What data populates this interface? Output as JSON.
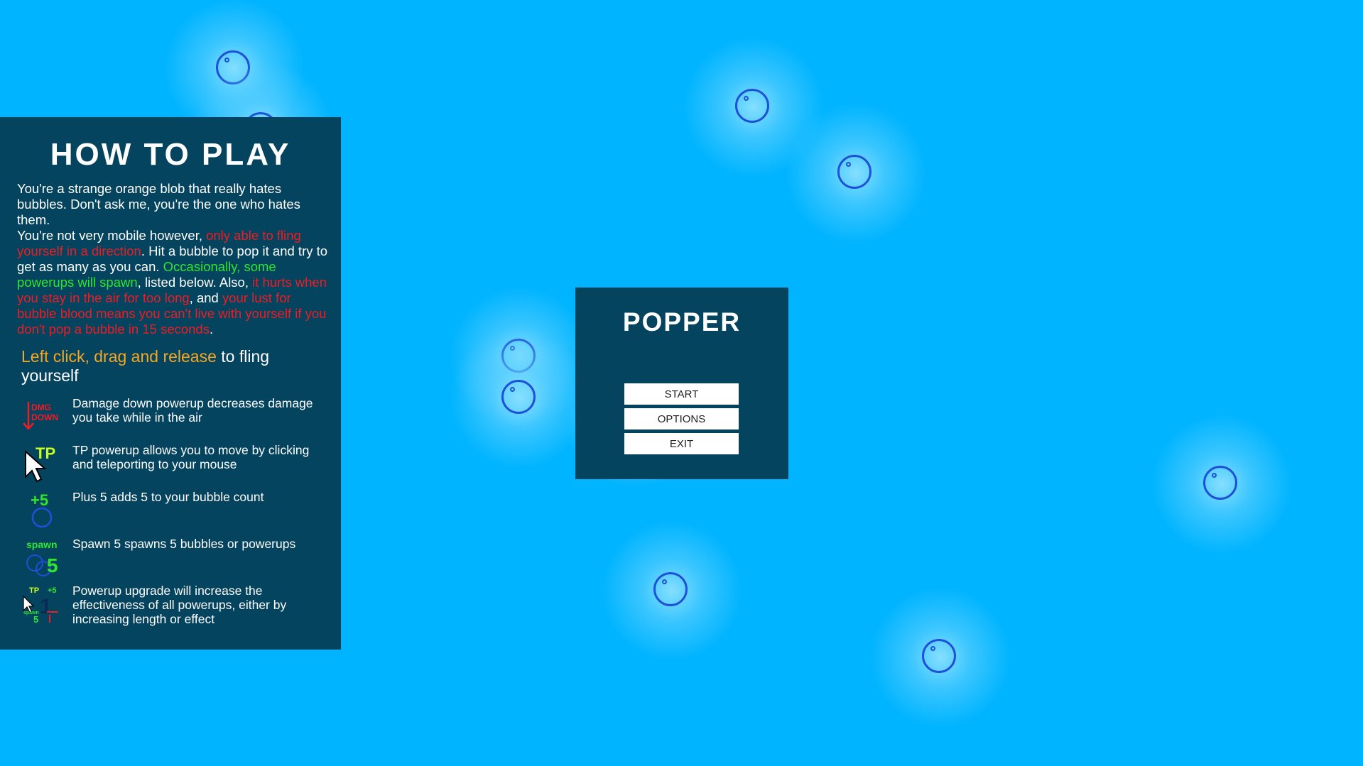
{
  "how_to_play": {
    "title": "HOW TO PLAY",
    "intro": "You're a strange orange blob that really hates bubbles. Don't ask me, you're the one who hates them.",
    "p2_a": "You're not very mobile however, ",
    "p2_b": "only able to fling yourself in a direction",
    "p2_c": ". Hit a bubble to pop it and try to get as many as you can. ",
    "p2_d": "Occasionally, some powerups will spawn",
    "p2_e": ", listed below. Also, ",
    "p2_f": "it hurts when you stay in the air for too long",
    "p2_g": ", and ",
    "p2_h": "your lust for bubble blood means you can't live with yourself if you don't pop a bubble in 15 seconds",
    "p2_i": ".",
    "controls_a": "Left click, drag and release",
    "controls_b": " to fling yourself",
    "powerups": [
      {
        "icon": "damage-down-icon",
        "icon_text_1": "DMG",
        "icon_text_2": "DOWN",
        "desc": "Damage down powerup decreases damage you take while in the air"
      },
      {
        "icon": "teleport-icon",
        "icon_text_1": "TP",
        "desc": "TP powerup allows you to move by clicking and teleporting to your mouse"
      },
      {
        "icon": "plus-five-icon",
        "icon_text_1": "+5",
        "desc": "Plus 5 adds 5 to your bubble count"
      },
      {
        "icon": "spawn-five-icon",
        "icon_text_1": "spawn",
        "icon_text_2": "5",
        "desc": "Spawn 5 spawns 5 bubbles or powerups"
      },
      {
        "icon": "powerup-upgrade-icon",
        "icon_text_1": "TP",
        "icon_text_2": "+5",
        "icon_text_3": "spawn",
        "icon_text_4": "5",
        "desc": "Powerup upgrade will increase the effectiveness of all powerups, either by increasing length or effect"
      }
    ]
  },
  "menu": {
    "title": "POPPER",
    "start_label": "START",
    "options_label": "OPTIONS",
    "exit_label": "EXIT"
  },
  "colors": {
    "background": "#00b4ff",
    "panel": "#04445f",
    "highlight_red": "#ee1c24",
    "highlight_green": "#2ee62e",
    "highlight_orange": "#f5a623",
    "bubble_outline": "#1e50d8"
  }
}
